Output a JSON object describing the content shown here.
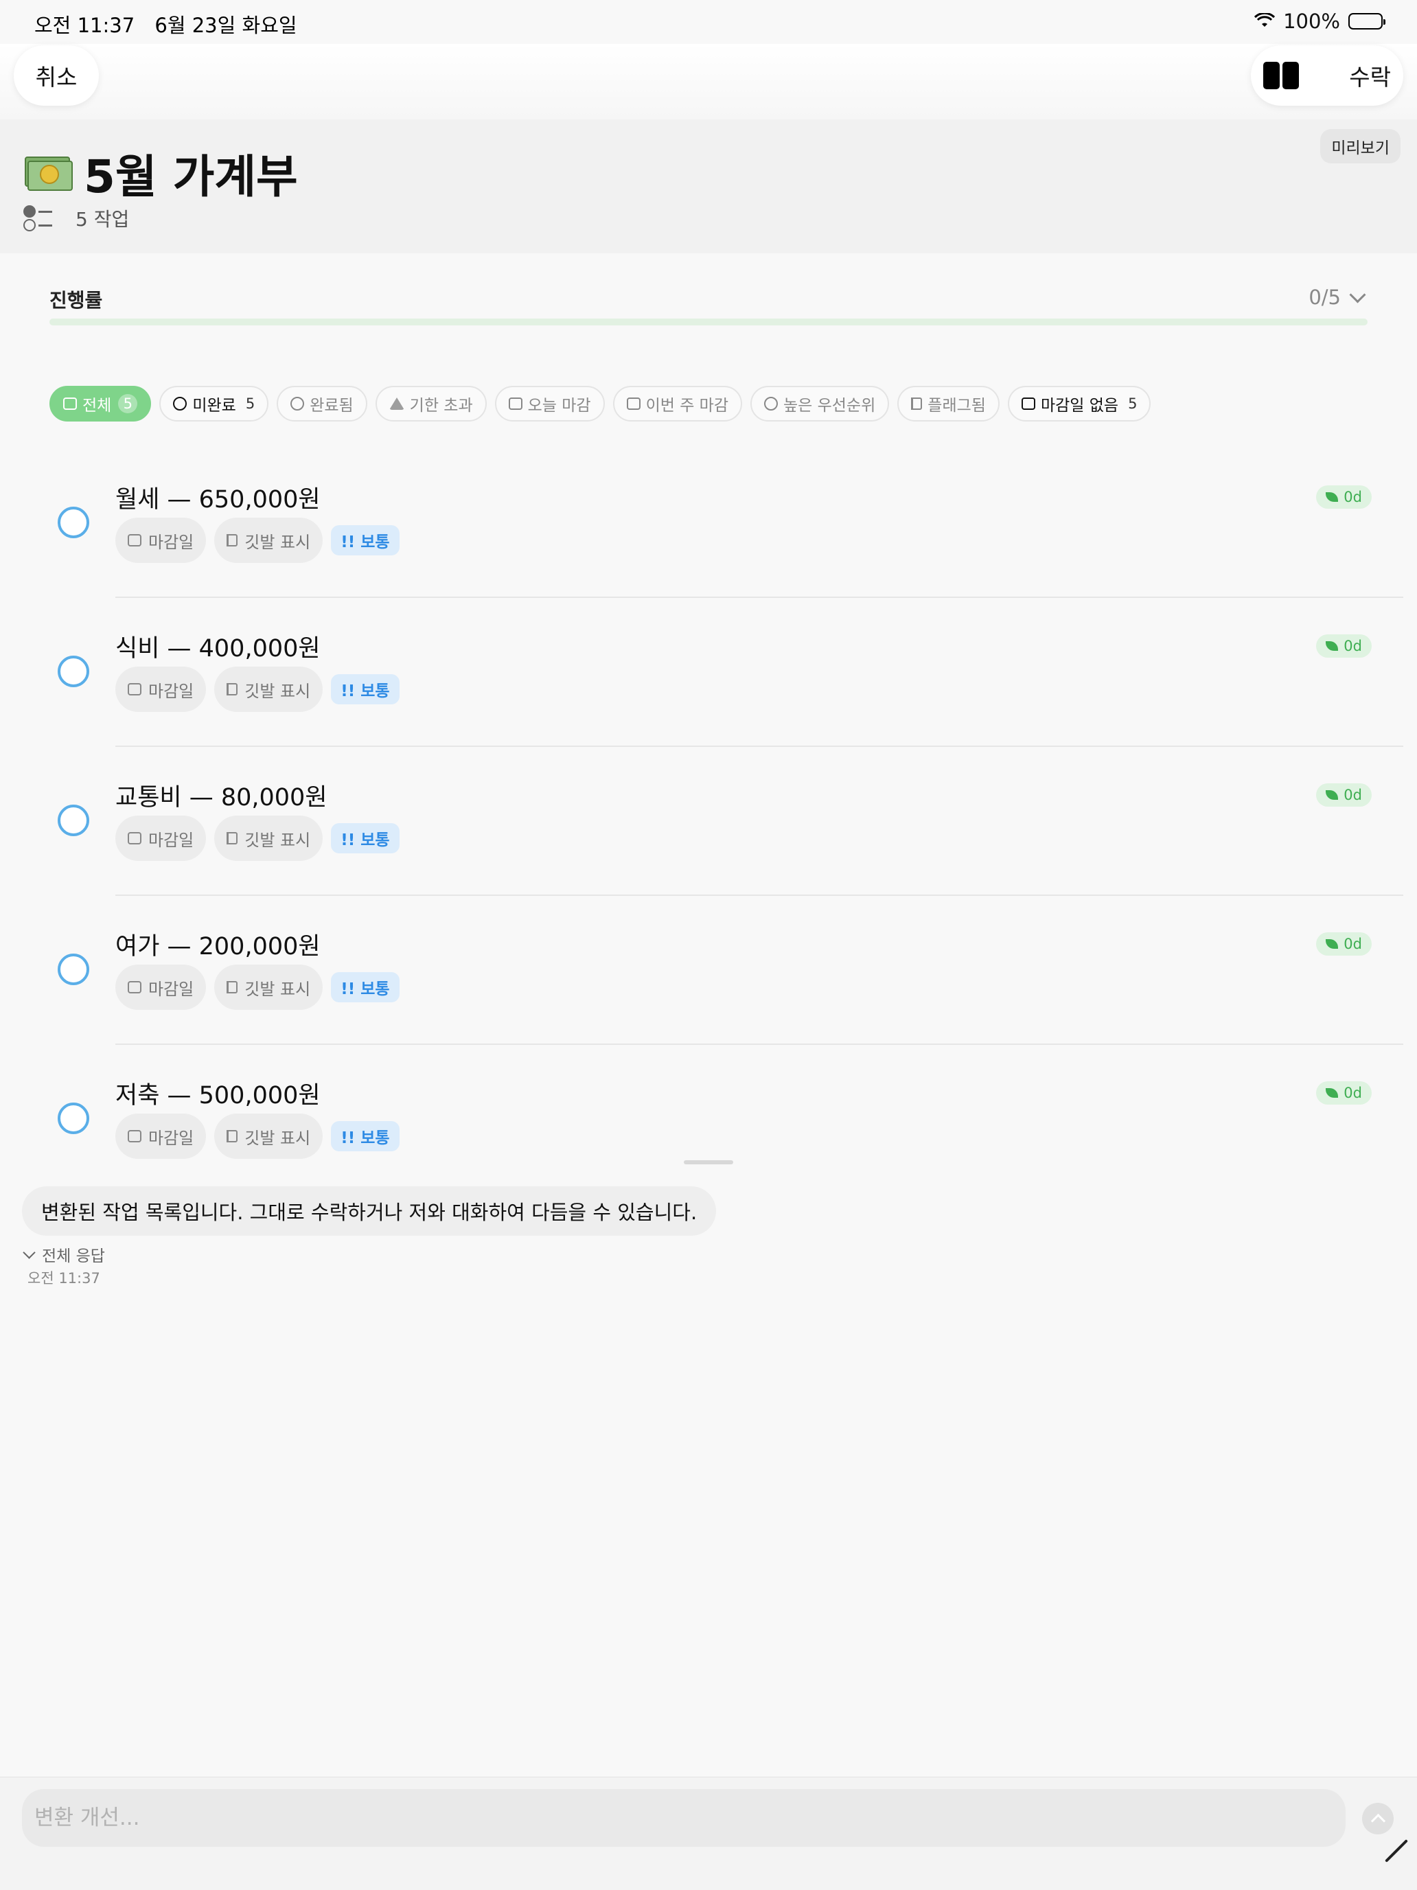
{
  "status_bar": {
    "time": "오전 11:37",
    "date": "6월 23일 화요일",
    "battery": "100%"
  },
  "nav": {
    "cancel": "취소",
    "accept": "수락"
  },
  "header": {
    "title": "5월 가계부",
    "icon": "money-bag-icon",
    "task_count": "5 작업",
    "preview": "미리보기"
  },
  "progress": {
    "label": "진행률",
    "value": "0/5",
    "fraction": 0
  },
  "filters": [
    {
      "label": "전체",
      "count": "5",
      "icon": "inbox-icon",
      "active": true
    },
    {
      "label": "미완료",
      "count": "5",
      "icon": "circle-icon"
    },
    {
      "label": "완료됨",
      "count": "",
      "icon": "check-circle-icon"
    },
    {
      "label": "기한 초과",
      "count": "",
      "icon": "warning-icon"
    },
    {
      "label": "오늘 마감",
      "count": "",
      "icon": "calendar-clock-icon"
    },
    {
      "label": "이번 주 마감",
      "count": "",
      "icon": "calendar-icon"
    },
    {
      "label": "높은 우선순위",
      "count": "",
      "icon": "arrow-up-circle-icon"
    },
    {
      "label": "플래그됨",
      "count": "",
      "icon": "flag-icon"
    },
    {
      "label": "마감일 없음",
      "count": "5",
      "icon": "calendar-off-icon"
    }
  ],
  "task_tags": {
    "due": "마감일",
    "flag": "깃발 표시",
    "priority": "!! 보통"
  },
  "tasks": [
    {
      "name": "월세 — 650,000원",
      "badge": "0d"
    },
    {
      "name": "식비 — 400,000원",
      "badge": "0d"
    },
    {
      "name": "교통비 — 80,000원",
      "badge": "0d"
    },
    {
      "name": "여가 — 200,000원",
      "badge": "0d"
    },
    {
      "name": "저축 — 500,000원",
      "badge": "0d"
    }
  ],
  "chat": {
    "message": "변환된 작업 목록입니다. 그대로 수락하거나 저와 대화하여 다듬을 수 있습니다.",
    "full_response": "전체 응답",
    "time": "오전 11:37"
  },
  "composer": {
    "placeholder": "변환 개선..."
  }
}
